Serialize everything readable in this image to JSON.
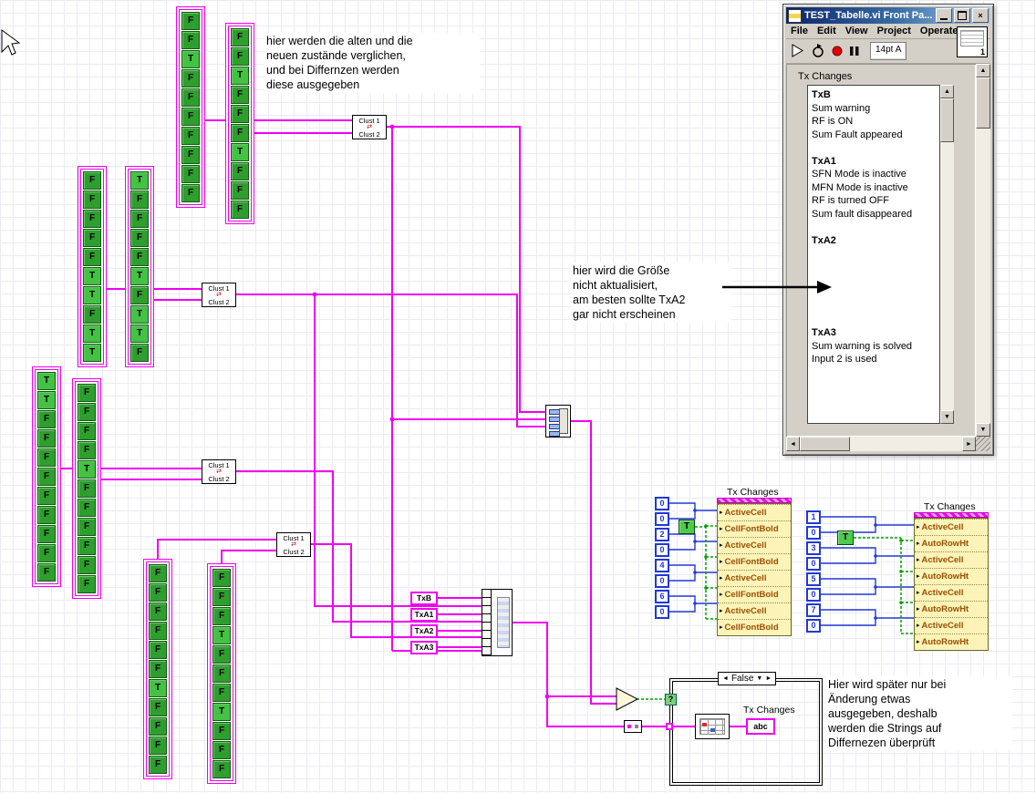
{
  "icons": {
    "swap": "⇄",
    "close": "×",
    "question": "?",
    "up": "▲",
    "down": "▼",
    "left": "◄",
    "right": "►",
    "write_arrow": "▸"
  },
  "colors": {
    "wire_cluster": "#F000F0",
    "wire_numeric": "#2238D4",
    "wire_boolean": "#00A000",
    "bool_true_green": "#43C243",
    "titlebar_blue": "#0A246A"
  },
  "notes": {
    "compare": "hier werden die alten und die\nneuen zustände verglichen,\nund bei Differnzen werden\ndiese ausgegeben",
    "size": "hier wird die Größe\nnicht aktualisiert,\nam besten sollte TxA2\ngar nicht erscheinen",
    "change": "Hier wird später nur bei\nÄnderung etwas\nausgegeben, deshalb\nwerden die Strings auf\nDiffernezen überprüft"
  },
  "cluster_node": {
    "top": "Clust 1",
    "bottom": "Clust 2"
  },
  "string_constants": [
    "TxB",
    "TxA1",
    "TxA2",
    "TxA3"
  ],
  "bool_arrays": {
    "a1": [
      "F",
      "F",
      "T",
      "F",
      "F",
      "F",
      "F",
      "F",
      "F",
      "F"
    ],
    "a2": [
      "F",
      "F",
      "T",
      "F",
      "F",
      "F",
      "T",
      "F",
      "F",
      "F"
    ],
    "a3": [
      "F",
      "F",
      "F",
      "F",
      "F",
      "T",
      "T",
      "F",
      "T",
      "T"
    ],
    "a4": [
      "T",
      "F",
      "F",
      "F",
      "F",
      "T",
      "F",
      "T",
      "T",
      "F"
    ],
    "a5": [
      "T",
      "T",
      "F",
      "F",
      "F",
      "F",
      "F",
      "F",
      "F",
      "F",
      "F"
    ],
    "a6": [
      "F",
      "F",
      "F",
      "F",
      "T",
      "F",
      "F",
      "F",
      "F",
      "F",
      "F"
    ],
    "a7": [
      "F",
      "F",
      "F",
      "F",
      "F",
      "F",
      "T",
      "F",
      "F",
      "F",
      "F"
    ],
    "a8": [
      "F",
      "F",
      "F",
      "T",
      "F",
      "F",
      "F",
      "T",
      "F",
      "F",
      "F"
    ]
  },
  "numeric_constants": {
    "left": [
      "0",
      "0",
      "2",
      "0",
      "4",
      "0",
      "6",
      "0"
    ],
    "right": [
      "1",
      "0",
      "3",
      "0",
      "5",
      "0",
      "7",
      "0"
    ]
  },
  "bool_constant": "T",
  "property_nodes": {
    "left": {
      "label": "Tx Changes",
      "rows": [
        "ActiveCell",
        "CellFontBold",
        "ActiveCell",
        "CellFontBold",
        "ActiveCell",
        "CellFontBold",
        "ActiveCell",
        "CellFontBold"
      ]
    },
    "right": {
      "label": "Tx Changes",
      "rows": [
        "ActiveCell",
        "AutoRowHt",
        "ActiveCell",
        "AutoRowHt",
        "ActiveCell",
        "AutoRowHt",
        "ActiveCell",
        "AutoRowHt"
      ]
    }
  },
  "case_structure": {
    "selector": "False"
  },
  "string_indicator": {
    "label": "Tx Changes",
    "glyph": "abc"
  },
  "window": {
    "title": "TEST_Tabelle.vi Front Pa...",
    "menus": [
      "File",
      "Edit",
      "View",
      "Project",
      "Operate"
    ],
    "toolbar": {
      "font": "14pt A",
      "badge": "1"
    },
    "panel_label": "Tx Changes",
    "table_lines": [
      {
        "text": "TxB",
        "bold": true
      },
      {
        "text": "Sum warning",
        "bold": false
      },
      {
        "text": "RF is ON",
        "bold": false
      },
      {
        "text": "Sum Fault appeared",
        "bold": false
      },
      {
        "text": "",
        "bold": false
      },
      {
        "text": "TxA1",
        "bold": true
      },
      {
        "text": "SFN Mode is inactive",
        "bold": false
      },
      {
        "text": "MFN Mode is inactive",
        "bold": false
      },
      {
        "text": "RF is turned OFF",
        "bold": false
      },
      {
        "text": "Sum fault disappeared",
        "bold": false
      },
      {
        "text": "",
        "bold": false
      },
      {
        "text": "TxA2",
        "bold": true
      },
      {
        "text": "",
        "bold": false
      },
      {
        "text": "",
        "bold": false
      },
      {
        "text": "",
        "bold": false
      },
      {
        "text": "",
        "bold": false
      },
      {
        "text": "",
        "bold": false
      },
      {
        "text": "",
        "bold": false
      },
      {
        "text": "TxA3",
        "bold": true
      },
      {
        "text": "Sum warning is solved",
        "bold": false
      },
      {
        "text": "Input 2 is used",
        "bold": false
      }
    ]
  }
}
